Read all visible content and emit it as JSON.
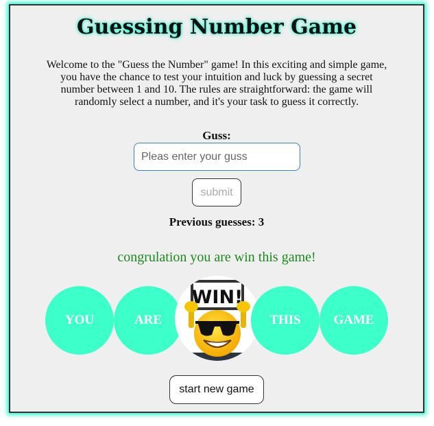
{
  "header": {
    "title": "Guessing Number Game"
  },
  "intro": {
    "text": "Welcome to the \"Guess the Number\" game! In this exciting and simple game, you have the chance to test your intuition and luck by guessing a secret number between 1 and 10. The rules are straightforward: the game will randomly select a number, and it's your task to guess it correctly."
  },
  "form": {
    "label": "Guss:",
    "placeholder": "Pleas enter your guss",
    "value": "",
    "submit_label": "submit"
  },
  "status": {
    "previous_label": "Previous guesses: 3",
    "win_message": "congrulation you are win this game!"
  },
  "win_banner": {
    "words": [
      "YOU",
      "ARE",
      "THIS",
      "GAME"
    ],
    "image_sign_text": "WIN!",
    "image_icon": "sunglasses-emoji-holding-win-sign",
    "circle_color": "#3cffc9"
  },
  "actions": {
    "new_game_label": "start new game"
  },
  "colors": {
    "accent_glow": "#38f5cf",
    "success": "#1a8a1a",
    "input_border": "#3b7fc9"
  }
}
